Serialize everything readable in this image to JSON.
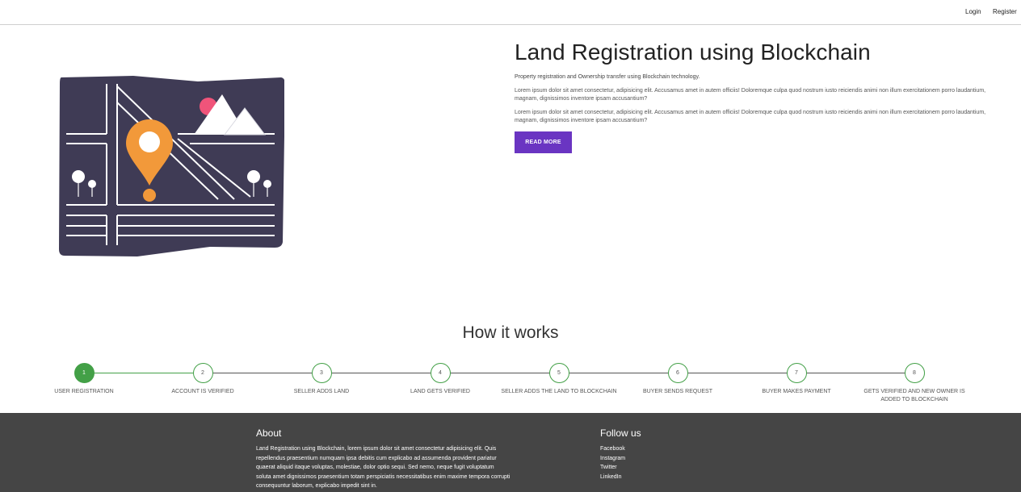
{
  "nav": {
    "login": "Login",
    "register": "Register"
  },
  "hero": {
    "title": "Land Registration using Blockchain",
    "subtitle": "Property registration and Ownership transfer using Blockchain technology.",
    "paragraphs": [
      "Lorem ipsum dolor sit amet consectetur, adipisicing elit. Accusamus amet in autem officiis! Doloremque culpa quod nostrum iusto reiciendis animi non illum exercitationem porro laudantium, magnam, dignissimos inventore ipsam accusantium?",
      "Lorem ipsum dolor sit amet consectetur, adipisicing elit. Accusamus amet in autem officiis! Doloremque culpa quod nostrum iusto reiciendis animi non illum exercitationem porro laudantium, magnam, dignissimos inventore ipsam accusantium?"
    ],
    "read_more": "READ MORE",
    "illustration_icon": "map-pin-illustration"
  },
  "how_it_works": {
    "title": "How it works",
    "active_step": 1,
    "steps": [
      {
        "number": "1",
        "label": "USER REGISTRATION"
      },
      {
        "number": "2",
        "label": "ACCOUNT IS VERIFIED"
      },
      {
        "number": "3",
        "label": "SELLER ADDS LAND"
      },
      {
        "number": "4",
        "label": "LAND GETS VERIFIED"
      },
      {
        "number": "5",
        "label": "SELLER ADDS THE LAND TO BLOCKCHAIN"
      },
      {
        "number": "6",
        "label": "BUYER SENDS REQUEST"
      },
      {
        "number": "7",
        "label": "BUYER MAKES PAYMENT"
      },
      {
        "number": "8",
        "label": "GETS VERIFIED AND NEW OWNER IS ADDED TO BLOCKCHAIN"
      }
    ]
  },
  "footer": {
    "about_heading": "About",
    "about_text": "Land Registration using Blockchain, lorem ipsum dolor sit amet consectetur adipisicing elit. Quis repellendus praesentium numquam ipsa debitis cum explicabo ad assumenda provident pariatur quaerat aliquid itaque voluptas, molestiae, dolor optio sequi. Sed nemo, neque fugit voluptatum soluta amet dignissimos praesentium totam perspiciatis necessitatibus enim maxime tempora corrupti consequuntur laborum, explicabo impedit sint in.",
    "follow_heading": "Follow us",
    "social": [
      "Facebook",
      "Instagram",
      "Twitter",
      "LinkedIn"
    ]
  },
  "colors": {
    "accent_purple": "#6a35c2",
    "step_green": "#43a047",
    "footer_bg": "#454545",
    "map_dark": "#3f3b55",
    "pin_orange": "#f2993a",
    "sun_pink": "#f0547a"
  }
}
